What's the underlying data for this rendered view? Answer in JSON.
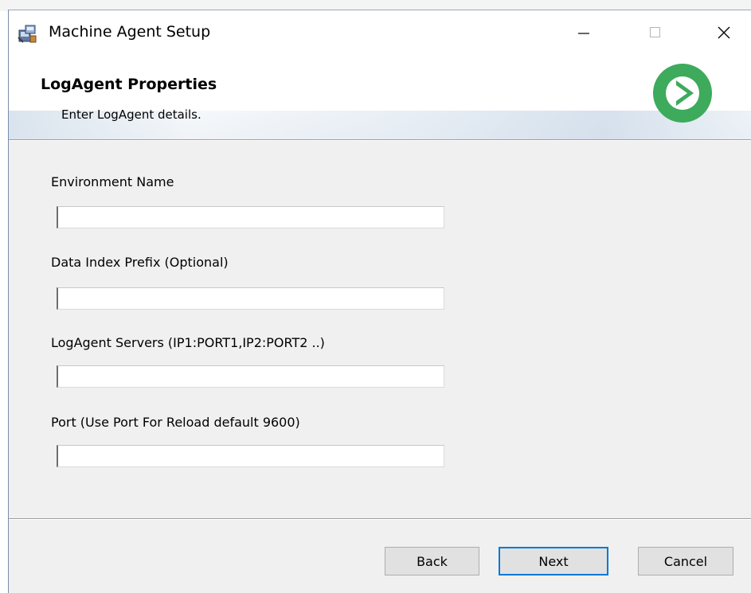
{
  "window": {
    "title": "Machine Agent Setup",
    "controls": {
      "minimize": "minimize-icon",
      "maximize": "maximize-icon",
      "close": "close-icon"
    }
  },
  "banner": {
    "title": "LogAgent Properties",
    "subtitle": "Enter LogAgent details.",
    "logo_color": "#3daa5c"
  },
  "form": {
    "fields": [
      {
        "label": "Environment Name",
        "value": ""
      },
      {
        "label": "Data Index Prefix (Optional)",
        "value": ""
      },
      {
        "label": "LogAgent Servers (IP1:PORT1,IP2:PORT2 ..)",
        "value": ""
      },
      {
        "label": "Port (Use Port For Reload default 9600)",
        "value": ""
      }
    ]
  },
  "buttons": {
    "back": "Back",
    "next": "Next",
    "cancel": "Cancel"
  },
  "colors": {
    "focus_border": "#0078d7",
    "dialog_bg": "#f0f0f0"
  }
}
